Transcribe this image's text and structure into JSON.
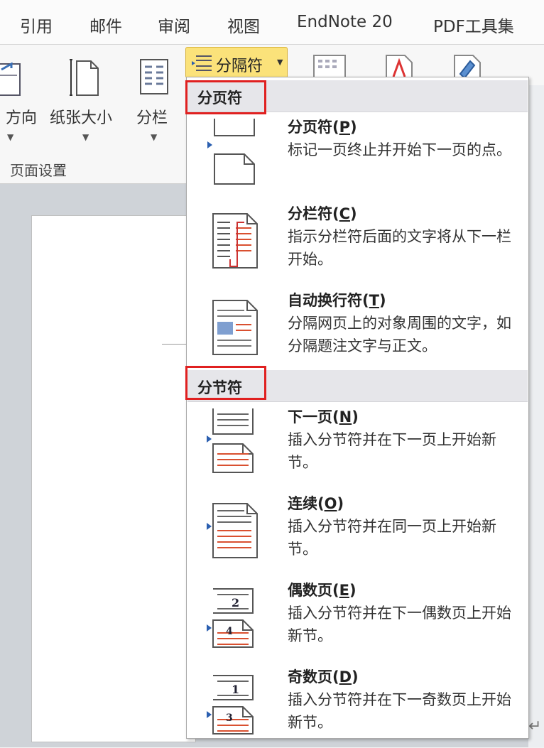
{
  "tabs": [
    "引用",
    "邮件",
    "审阅",
    "视图",
    "EndNote 20",
    "PDF工具集"
  ],
  "ribbon": {
    "orientation_label": "方向",
    "paper_size_label": "纸张大小",
    "columns_label": "分栏",
    "group_label": "页面设置",
    "breaks_button_label": "分隔符"
  },
  "menu": {
    "section1": {
      "title": "分页符",
      "items": [
        {
          "title_text": "分页符",
          "key": "P",
          "description": "标记一页终止并开始下一页的点。",
          "icon": "page-break-icon"
        },
        {
          "title_text": "分栏符",
          "key": "C",
          "description": "指示分栏符后面的文字将从下一栏开始。",
          "icon": "column-break-icon"
        },
        {
          "title_text": "自动换行符",
          "key": "T",
          "description": "分隔网页上的对象周围的文字，如分隔题注文字与正文。",
          "icon": "text-wrapping-break-icon"
        }
      ]
    },
    "section2": {
      "title": "分节符",
      "items": [
        {
          "title_text": "下一页",
          "key": "N",
          "description": "插入分节符并在下一页上开始新节。",
          "icon": "next-page-section-icon"
        },
        {
          "title_text": "连续",
          "key": "O",
          "description": "插入分节符并在同一页上开始新节。",
          "icon": "continuous-section-icon"
        },
        {
          "title_text": "偶数页",
          "key": "E",
          "description": "插入分节符并在下一偶数页上开始新节。",
          "icon": "even-page-section-icon"
        },
        {
          "title_text": "奇数页",
          "key": "D",
          "description": "插入分节符并在下一奇数页上开始新节。",
          "icon": "odd-page-section-icon"
        }
      ]
    }
  },
  "colors": {
    "highlight": "#fbe27a",
    "red_box": "#e02020",
    "section_bg": "#e6e6ea"
  },
  "icon_numbers": {
    "even_top": "2",
    "even_bottom": "4",
    "odd_top": "1",
    "odd_bottom": "3"
  }
}
